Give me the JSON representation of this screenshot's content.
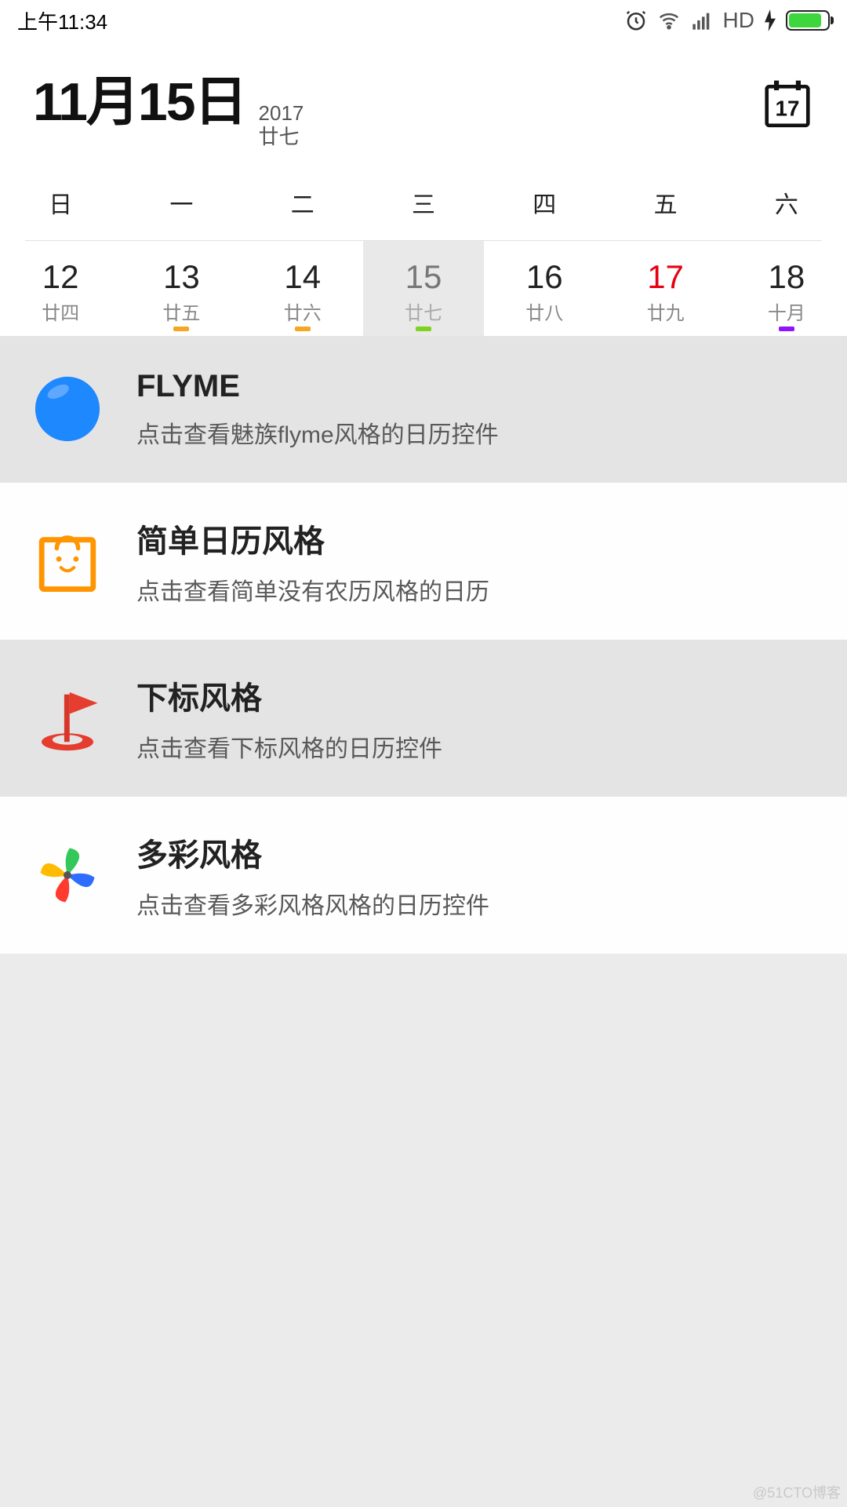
{
  "status": {
    "time": "上午11:34",
    "hd": "HD"
  },
  "header": {
    "date": "11月15日",
    "year": "2017",
    "lunar": "廿七",
    "today_icon_day": "17"
  },
  "weekdays": [
    "日",
    "一",
    "二",
    "三",
    "四",
    "五",
    "六"
  ],
  "week": [
    {
      "num": "12",
      "lunar": "廿四",
      "selected": false,
      "red": false,
      "dot": null
    },
    {
      "num": "13",
      "lunar": "廿五",
      "selected": false,
      "red": false,
      "dot": "orange"
    },
    {
      "num": "14",
      "lunar": "廿六",
      "selected": false,
      "red": false,
      "dot": "orange"
    },
    {
      "num": "15",
      "lunar": "廿七",
      "selected": true,
      "red": false,
      "dot": "green"
    },
    {
      "num": "16",
      "lunar": "廿八",
      "selected": false,
      "red": false,
      "dot": null
    },
    {
      "num": "17",
      "lunar": "廿九",
      "selected": false,
      "red": true,
      "dot": null
    },
    {
      "num": "18",
      "lunar": "十月",
      "selected": false,
      "red": false,
      "dot": "purple"
    }
  ],
  "items": [
    {
      "title": "FLYME",
      "sub": "点击查看魅族flyme风格的日历控件"
    },
    {
      "title": "简单日历风格",
      "sub": "点击查看简单没有农历风格的日历"
    },
    {
      "title": "下标风格",
      "sub": "点击查看下标风格的日历控件"
    },
    {
      "title": "多彩风格",
      "sub": "点击查看多彩风格风格的日历控件"
    }
  ],
  "watermark": "@51CTO博客"
}
